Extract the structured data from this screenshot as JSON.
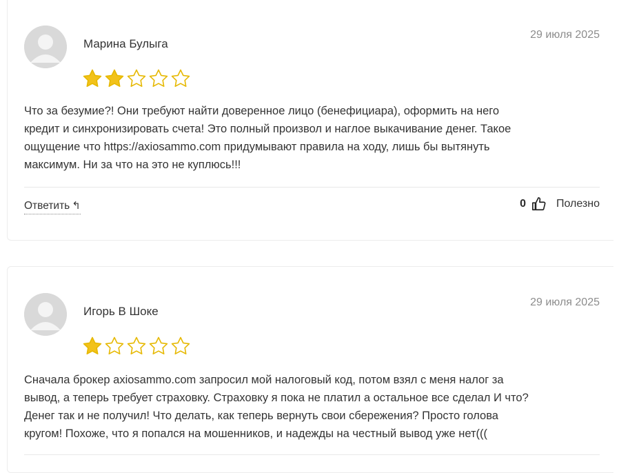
{
  "colors": {
    "star_fill": "#f2c21a",
    "star_outline": "#e6b800",
    "avatar_bg": "#d9d9d9",
    "date": "#8c8c8c"
  },
  "reviews": [
    {
      "author": "Марина Булыга",
      "date": "29 июля 2025",
      "rating": 2,
      "max_rating": 5,
      "text_lines": [
        "Что за безумие?! Они требуют найти доверенное лицо (бенефициара), оформить на него",
        "кредит и синхронизировать счета! Это полный произвол и наглое выкачивание денег. Такое",
        "ощущение что https://axiosammo.com придумывают правила на ходу, лишь бы вытянуть",
        "максимум. Ни за что на это не куплюсь!!!"
      ],
      "reply_label": "Ответить",
      "reply_icon": "reply-arrow-icon",
      "helpful_count": "0",
      "helpful_label": "Полезно"
    },
    {
      "author": "Игорь В Шоке",
      "date": "29 июля 2025",
      "rating": 1,
      "max_rating": 5,
      "text_lines": [
        "Сначала брокер axiosammo.com запросил мой налоговый код, потом взял с меня налог за",
        "вывод, а теперь требует страховку. Страховку я пока не платил а остальное все сделал И что?",
        "Денег так и не получил! Что делать, как теперь вернуть свои сбережения? Просто голова",
        "кругом! Похоже, что я попался на мошенников, и надежды на честный вывод уже нет((("
      ]
    }
  ]
}
